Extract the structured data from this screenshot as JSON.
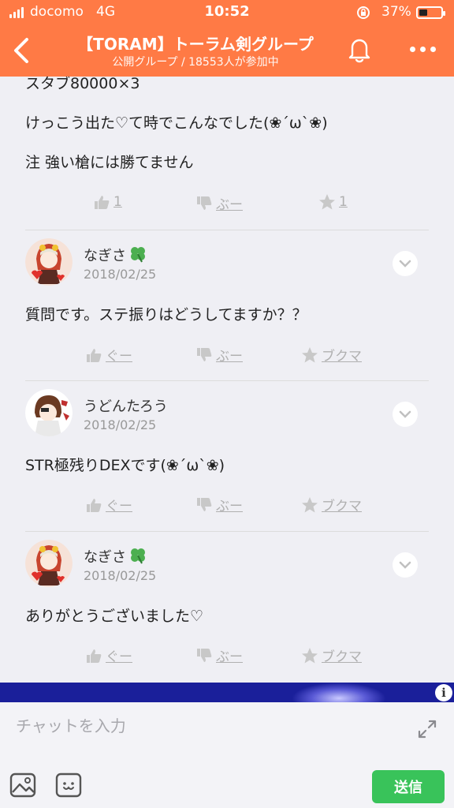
{
  "status_bar": {
    "carrier": "docomo",
    "network": "4G",
    "time": "10:52",
    "battery_percent": "37%"
  },
  "header": {
    "title": "【TORAM】トーラム剣グループ",
    "subtitle": "公開グループ / 18553人が参加中"
  },
  "post": {
    "lines": [
      "スタブ80000×3",
      "けっこう出た♡て時でこんなでした(❀´ω`❀)",
      "注 強い槍には勝てません"
    ],
    "like_count": "1",
    "boo_label": "ぶー",
    "bookmark_count": "1"
  },
  "comments": [
    {
      "name": "なぎさ",
      "date": "2018/02/25",
      "text": "質問です。ステ振りはどうしてますか？？",
      "like_label": "ぐー",
      "boo_label": "ぶー",
      "bookmark_label": "ブクマ"
    },
    {
      "name": "うどんたろう",
      "date": "2018/02/25",
      "text": "STR極残りDEXです(❀´ω`❀)",
      "like_label": "ぐー",
      "boo_label": "ぶー",
      "bookmark_label": "ブクマ"
    },
    {
      "name": "なぎさ",
      "date": "2018/02/25",
      "text": "ありがとうございました♡",
      "like_label": "ぐー",
      "boo_label": "ぶー",
      "bookmark_label": "ブクマ"
    }
  ],
  "ad": {
    "info": "i"
  },
  "composer": {
    "placeholder": "チャットを入力",
    "send_label": "送信"
  },
  "colors": {
    "header_bg": "#ff7a45",
    "send_bg": "#39c35a"
  }
}
